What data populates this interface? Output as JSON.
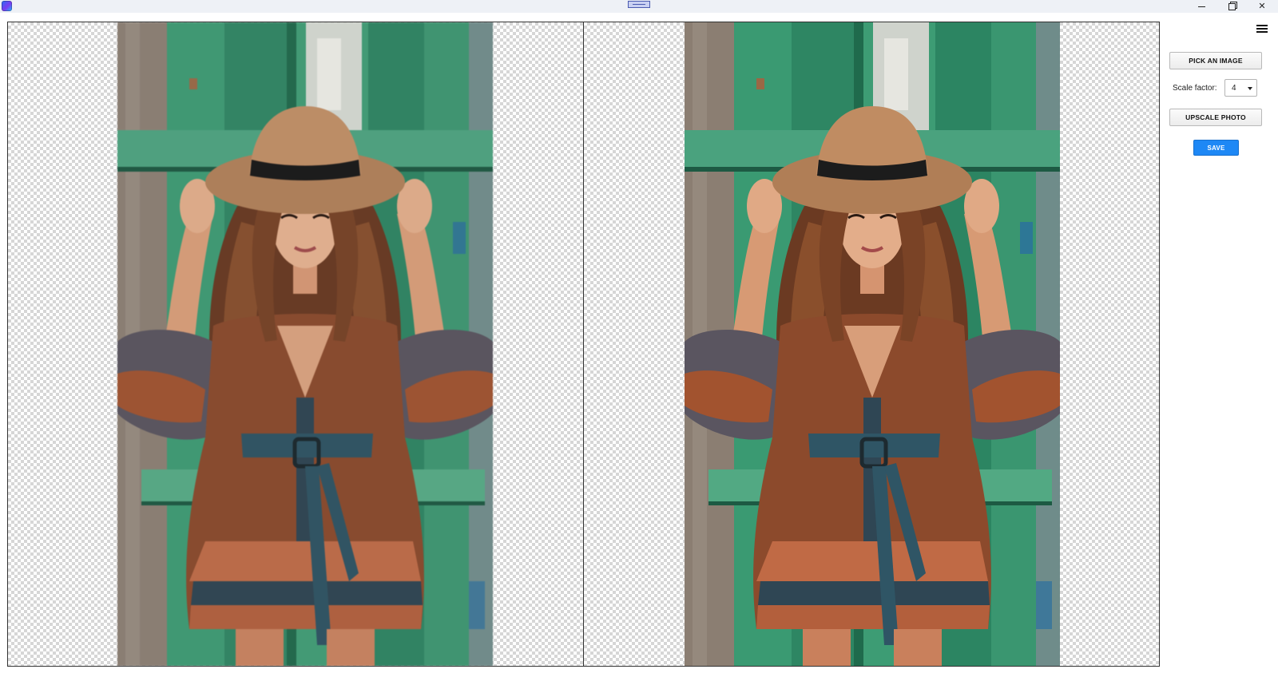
{
  "window": {
    "app_icon": "app-logo-icon",
    "controls": [
      "minimize-icon",
      "maximize-icon",
      "close-icon"
    ]
  },
  "panes": {
    "original": {
      "content": "portrait-photo",
      "background": "transparency-checkerboard"
    },
    "upscaled": {
      "content": "portrait-photo",
      "background": "transparency-checkerboard"
    }
  },
  "sidebar": {
    "menu_icon": "hamburger-menu-icon",
    "pick_image_label": "PICK AN IMAGE",
    "scale_factor_label": "Scale factor:",
    "scale_factor_value": "4",
    "upscale_label": "UPSCALE PHOTO",
    "save_label": "SAVE"
  },
  "colors": {
    "save_button": "#1e88f5",
    "titlebar": "#eef1f6"
  }
}
